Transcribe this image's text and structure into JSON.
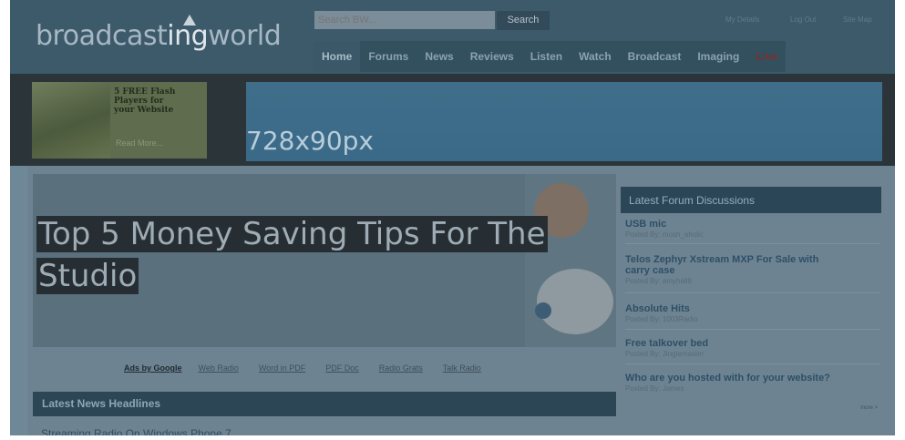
{
  "header": {
    "logo_prefix": "broadcast",
    "logo_highlight": "ing",
    "logo_suffix": "world",
    "search_placeholder": "Search BW...",
    "search_button": "Search",
    "util_links": [
      "My Details",
      "Log Out",
      "Site Map"
    ]
  },
  "nav": [
    "Home",
    "Forums",
    "News",
    "Reviews",
    "Listen",
    "Watch",
    "Broadcast",
    "Imaging",
    "Live"
  ],
  "promo": {
    "line1": "5 FREE Flash",
    "line2": "Players for",
    "line3": "your Website",
    "more": "Read More..."
  },
  "ad_banner": "728x90px",
  "hero": {
    "line1": "Top 5 Money Saving Tips For The",
    "line2": "Studio"
  },
  "ads": {
    "by": "Ads by Google",
    "links": [
      "Web Radio",
      "Word in PDF",
      "PDF Doc",
      "Radio Grats",
      "Talk Radio"
    ]
  },
  "news": {
    "heading": "Latest News Headlines",
    "first_item": "Streaming Radio On Windows Phone 7"
  },
  "forum": {
    "heading": "Latest Forum Discussions",
    "posts": [
      {
        "title": "USB mic",
        "by": "Posted By: mosh_aholic"
      },
      {
        "title_1": "Telos Zephyr Xstream MXP For Sale with",
        "title_2": "carry case",
        "by": "Posted By: amyhall8"
      },
      {
        "title": "Absolute Hits",
        "by": "Posted By: 1003Radio"
      },
      {
        "title": "Free talkover bed",
        "by": "Posted By: Jinglemaster"
      },
      {
        "title": "Who are you hosted with for your website?",
        "by": "Posted By: James"
      }
    ],
    "more": "more >"
  },
  "colors": {
    "overlay_tint": "#6f8898",
    "header_bg": "#3d5a6b",
    "forum_head_bg": "#2b4657",
    "link_color": "#2d4f67"
  }
}
